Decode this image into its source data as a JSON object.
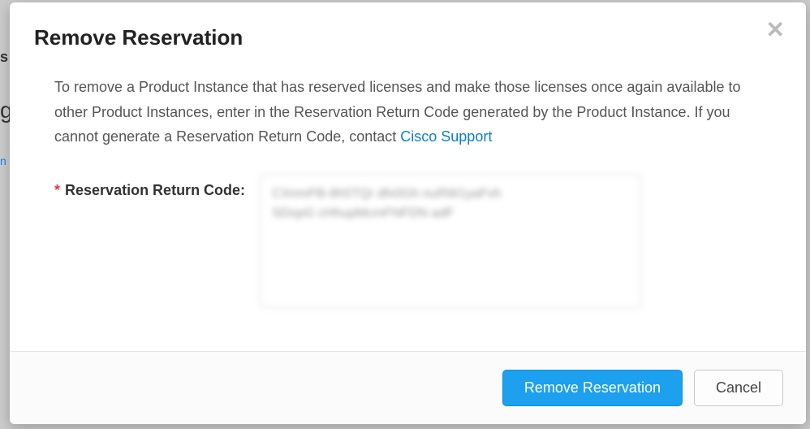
{
  "modal": {
    "title": "Remove Reservation",
    "description_pre": "To remove a Product Instance that has reserved licenses and make those licenses once again available to other Product Instances, enter in the Reservation Return Code generated by the Product Instance. If you cannot generate a Reservation Return Code, contact ",
    "support_link": "Cisco Support",
    "field_label": "Reservation Return Code:",
    "return_code_value": "CXmnPB-8h5TQr dfx0Gh nuRW1yaFvh\nSDopG cHhupMcmFNFDN adF",
    "primary_button": "Remove Reservation",
    "cancel_button": "Cancel"
  }
}
